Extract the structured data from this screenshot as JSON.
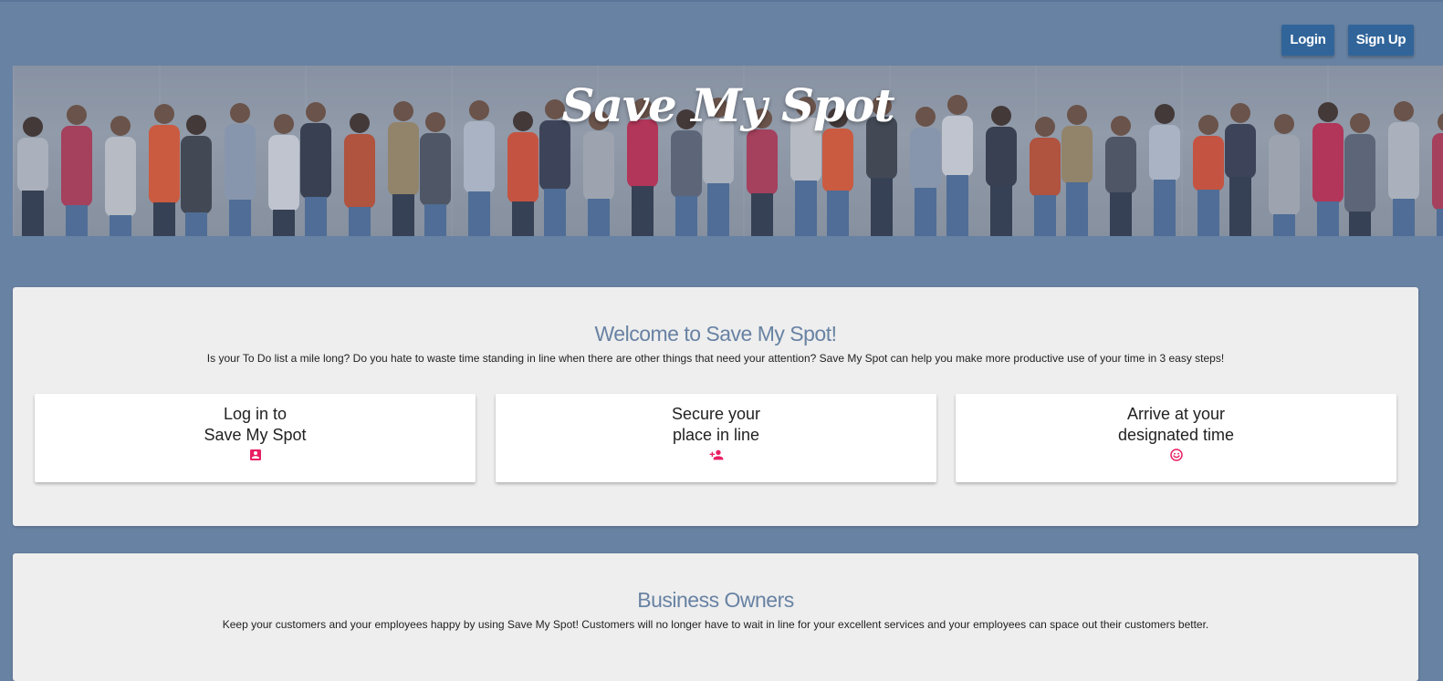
{
  "header": {
    "login_label": "Login",
    "signup_label": "Sign Up"
  },
  "banner": {
    "title": "Save My Spot"
  },
  "welcome": {
    "title": "Welcome to Save My Spot!",
    "description": "Is your To Do list a mile long? Do you hate to waste time standing in line when there are other things that need your attention? Save My Spot can help you make more productive use of your time in 3 easy steps!",
    "steps": [
      {
        "line1": "Log in to",
        "line2": "Save My Spot",
        "icon": "account-box-icon"
      },
      {
        "line1": "Secure your",
        "line2": "place in line",
        "icon": "person-add-icon"
      },
      {
        "line1": "Arrive at your",
        "line2": "designated time",
        "icon": "smiley-icon"
      }
    ]
  },
  "business": {
    "title": "Business Owners",
    "description": "Keep your customers and your employees happy by using Save My Spot! Customers will no longer have to wait in line for your excellent services and your employees can space out their customers better."
  },
  "colors": {
    "background": "#6882a3",
    "button": "#31659a",
    "panel": "#eeeeee",
    "accent_icon": "#e91e63",
    "heading": "#6882a3"
  }
}
